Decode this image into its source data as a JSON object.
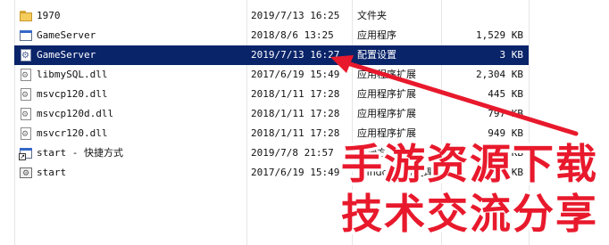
{
  "files": [
    {
      "name": "1970",
      "date": "2019/7/13 16:25",
      "type": "文件夹",
      "size": "",
      "icon": "folder-icon",
      "kind": "folder"
    },
    {
      "name": "GameServer",
      "date": "2018/8/6 13:25",
      "type": "应用程序",
      "size": "1,529 KB",
      "icon": "application-icon",
      "kind": "exe"
    },
    {
      "name": "GameServer",
      "date": "2019/7/13 16:27",
      "type": "配置设置",
      "size": "3 KB",
      "icon": "config-settings-icon",
      "kind": "config",
      "selected": true
    },
    {
      "name": "libmySQL.dll",
      "date": "2017/6/19 15:49",
      "type": "应用程序扩展",
      "size": "2,304 KB",
      "icon": "dll-icon",
      "kind": "dll"
    },
    {
      "name": "msvcp120.dll",
      "date": "2018/1/11 17:28",
      "type": "应用程序扩展",
      "size": "445 KB",
      "icon": "dll-icon",
      "kind": "dll"
    },
    {
      "name": "msvcp120d.dll",
      "date": "2018/1/11 17:28",
      "type": "应用程序扩展",
      "size": "797 KB",
      "icon": "dll-icon",
      "kind": "dll"
    },
    {
      "name": "msvcr120.dll",
      "date": "2018/1/11 17:28",
      "type": "应用程序扩展",
      "size": "949 KB",
      "icon": "dll-icon",
      "kind": "dll"
    },
    {
      "name": "start - 快捷方式",
      "date": "2019/7/8 21:57",
      "type": "快捷方式",
      "size": "1 KB",
      "icon": "shortcut-icon",
      "kind": "shortcut"
    },
    {
      "name": "start",
      "date": "2017/6/19 15:49",
      "type": "Windows 批处理",
      "size": "1 KB",
      "icon": "batch-file-icon",
      "kind": "batch"
    }
  ],
  "watermark": {
    "line1": "手游资源下载",
    "line2": "技术交流分享",
    "color": "#e8192c"
  },
  "colors": {
    "selection": "#0a246a",
    "annotation_arrow": "#e8192c"
  }
}
